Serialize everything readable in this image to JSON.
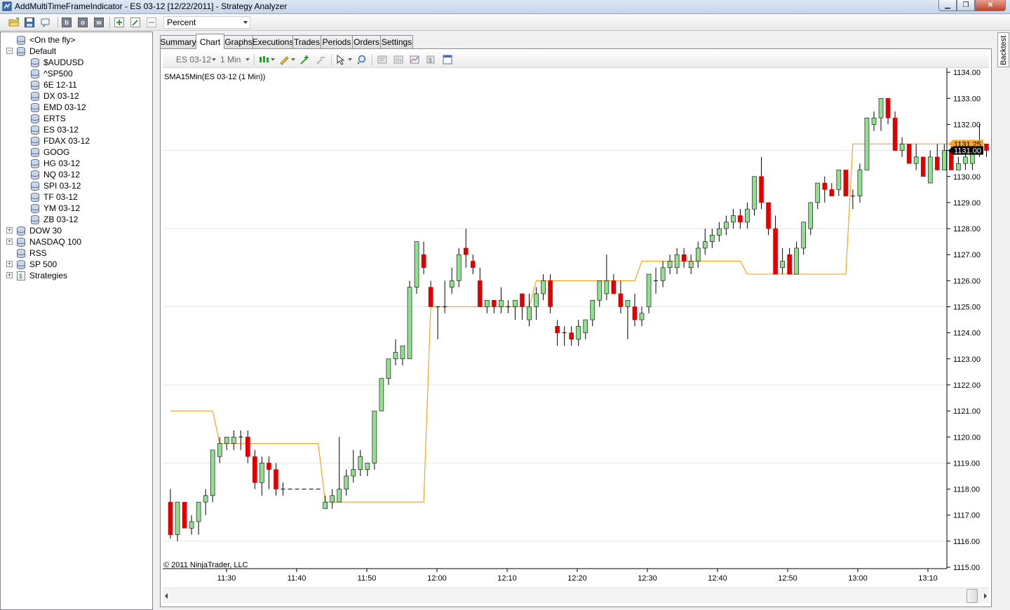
{
  "window": {
    "title": "AddMultiTimeFrameIndicator - ES 03-12 [12/22/2011] - Strategy Analyzer",
    "minimize": "▁",
    "maximize": "❐",
    "close": "✕"
  },
  "toolbar": {
    "b_label": "b",
    "o_label": "o",
    "w_label": "w",
    "display_select": "Percent"
  },
  "tree": {
    "items": [
      {
        "label": "<On the fly>",
        "level": 1,
        "expander": ""
      },
      {
        "label": "Default",
        "level": 0,
        "expander": "−"
      },
      {
        "label": "$AUDUSD",
        "level": 2,
        "expander": ""
      },
      {
        "label": "^SP500",
        "level": 2,
        "expander": ""
      },
      {
        "label": "6E 12-11",
        "level": 2,
        "expander": ""
      },
      {
        "label": "DX 03-12",
        "level": 2,
        "expander": ""
      },
      {
        "label": "EMD 03-12",
        "level": 2,
        "expander": ""
      },
      {
        "label": "ERTS",
        "level": 2,
        "expander": ""
      },
      {
        "label": "ES 03-12",
        "level": 2,
        "expander": ""
      },
      {
        "label": "FDAX 03-12",
        "level": 2,
        "expander": ""
      },
      {
        "label": "GOOG",
        "level": 2,
        "expander": ""
      },
      {
        "label": "HG 03-12",
        "level": 2,
        "expander": ""
      },
      {
        "label": "NQ 03-12",
        "level": 2,
        "expander": ""
      },
      {
        "label": "SPI 03-12",
        "level": 2,
        "expander": ""
      },
      {
        "label": "TF 03-12",
        "level": 2,
        "expander": ""
      },
      {
        "label": "YM 03-12",
        "level": 2,
        "expander": ""
      },
      {
        "label": "ZB 03-12",
        "level": 2,
        "expander": ""
      },
      {
        "label": "DOW 30",
        "level": 0,
        "expander": "+"
      },
      {
        "label": "NASDAQ 100",
        "level": 0,
        "expander": "+"
      },
      {
        "label": "RSS",
        "level": 0,
        "expander": ""
      },
      {
        "label": "SP 500",
        "level": 0,
        "expander": "+"
      },
      {
        "label": "Strategies",
        "level": 0,
        "expander": "+"
      }
    ]
  },
  "tabs": [
    "Summary",
    "Chart",
    "Graphs",
    "Executions",
    "Trades",
    "Periods",
    "Orders",
    "Settings"
  ],
  "active_tab": "Chart",
  "side_tab": "Backtest",
  "chart_toolbar": {
    "instrument": "ES 03-12",
    "interval": "1 Min"
  },
  "chart_data": {
    "type": "candlestick",
    "indicator_label": "SMA15Min(ES 03-12 (1 Min))",
    "copyright": "© 2011 NinjaTrader, LLC",
    "ylim": [
      1115,
      1134
    ],
    "y_ticks": [
      "1115.00",
      "1116.00",
      "1117.00",
      "1118.00",
      "1119.00",
      "1120.00",
      "1121.00",
      "1122.00",
      "1123.00",
      "1124.00",
      "1125.00",
      "1126.00",
      "1127.00",
      "1128.00",
      "1129.00",
      "1130.00",
      "1131.00",
      "1132.00",
      "1133.00",
      "1134.00"
    ],
    "x_ticks": [
      "11:30",
      "11:40",
      "11:50",
      "12:00",
      "12:10",
      "12:20",
      "12:30",
      "12:40",
      "12:50",
      "13:00",
      "13:10"
    ],
    "up_color": "#90e090",
    "down_color": "#e00000",
    "sma_color": "#f5a623",
    "price_markers": [
      {
        "label": "1131.25",
        "value": 1131.25,
        "color": "#f5a623"
      },
      {
        "label": "1131.00",
        "value": 1131.0,
        "color": "#000000"
      }
    ],
    "candles": [
      [
        1117.5,
        1118.0,
        1116.1,
        1116.25
      ],
      [
        1116.25,
        1117.5,
        1116.0,
        1117.5
      ],
      [
        1117.5,
        1117.5,
        1116.5,
        1116.5
      ],
      [
        1116.5,
        1117.0,
        1116.25,
        1116.75
      ],
      [
        1116.75,
        1117.5,
        1116.25,
        1117.5
      ],
      [
        1117.5,
        1118.0,
        1117.0,
        1117.75
      ],
      [
        1117.75,
        1119.5,
        1117.5,
        1119.5
      ],
      [
        1119.25,
        1120.0,
        1119.0,
        1119.75
      ],
      [
        1119.75,
        1120.0,
        1119.5,
        1120.0
      ],
      [
        1119.75,
        1120.25,
        1119.5,
        1120.0
      ],
      [
        1120.0,
        1120.25,
        1119.5,
        1120.0
      ],
      [
        1120.0,
        1120.25,
        1119.0,
        1119.25
      ],
      [
        1119.25,
        1119.5,
        1118.0,
        1118.25
      ],
      [
        1118.25,
        1119.25,
        1117.75,
        1119.0
      ],
      [
        1119.0,
        1119.25,
        1118.0,
        1118.75
      ],
      [
        1118.75,
        1119.0,
        1117.75,
        1118.0
      ],
      [
        1118.0,
        1118.25,
        1117.75,
        1118.0
      ],
      [
        1118.0,
        1118.0,
        1118.0,
        1118.0
      ],
      [
        1118.0,
        1118.0,
        1118.0,
        1118.0
      ],
      [
        1118.0,
        1118.0,
        1118.0,
        1118.0
      ],
      [
        1118.0,
        1118.0,
        1118.0,
        1118.0
      ],
      [
        1118.0,
        1118.0,
        1118.0,
        1118.0
      ],
      [
        1117.25,
        1117.75,
        1117.25,
        1117.5
      ],
      [
        1117.5,
        1118.0,
        1117.25,
        1117.75
      ],
      [
        1117.5,
        1120.0,
        1117.5,
        1118.0
      ],
      [
        1118.0,
        1118.75,
        1117.75,
        1118.5
      ],
      [
        1118.5,
        1119.5,
        1118.25,
        1118.75
      ],
      [
        1118.75,
        1119.5,
        1118.5,
        1119.25
      ],
      [
        1118.75,
        1119.0,
        1118.5,
        1119.0
      ],
      [
        1119.0,
        1121.0,
        1118.75,
        1121.0
      ],
      [
        1121.0,
        1122.25,
        1121.0,
        1122.25
      ],
      [
        1122.25,
        1123.0,
        1122.0,
        1123.0
      ],
      [
        1123.0,
        1123.75,
        1122.75,
        1123.25
      ],
      [
        1123.0,
        1123.5,
        1122.75,
        1123.5
      ],
      [
        1123.0,
        1126.0,
        1123.0,
        1125.75
      ],
      [
        1125.75,
        1127.5,
        1125.5,
        1127.5
      ],
      [
        1127.0,
        1127.5,
        1126.25,
        1126.5
      ],
      [
        1125.75,
        1126.0,
        1125.0,
        1125.0
      ],
      [
        1125.0,
        1125.0,
        1123.75,
        1125.0
      ],
      [
        1125.0,
        1126.0,
        1124.75,
        1125.0
      ],
      [
        1125.75,
        1126.5,
        1125.5,
        1126.0
      ],
      [
        1126.0,
        1127.25,
        1125.75,
        1127.0
      ],
      [
        1127.25,
        1128.0,
        1126.5,
        1127.0
      ],
      [
        1126.75,
        1127.0,
        1126.25,
        1126.5
      ],
      [
        1126.0,
        1126.5,
        1125.0,
        1125.0
      ],
      [
        1125.0,
        1125.25,
        1124.75,
        1125.25
      ],
      [
        1125.25,
        1125.25,
        1124.75,
        1125.0
      ],
      [
        1125.0,
        1125.75,
        1124.75,
        1125.25
      ],
      [
        1125.0,
        1125.25,
        1124.75,
        1125.0
      ],
      [
        1125.0,
        1125.25,
        1124.5,
        1125.25
      ],
      [
        1125.5,
        1125.5,
        1124.5,
        1125.0
      ],
      [
        1124.5,
        1125.5,
        1124.25,
        1125.0
      ],
      [
        1125.0,
        1125.75,
        1124.5,
        1125.5
      ],
      [
        1125.5,
        1126.25,
        1125.25,
        1126.0
      ],
      [
        1126.0,
        1126.25,
        1124.75,
        1125.0
      ],
      [
        1124.25,
        1124.5,
        1123.5,
        1124.0
      ],
      [
        1124.0,
        1124.25,
        1123.5,
        1124.0
      ],
      [
        1124.0,
        1124.25,
        1123.5,
        1123.75
      ],
      [
        1123.75,
        1124.5,
        1123.5,
        1124.25
      ],
      [
        1124.0,
        1124.5,
        1123.75,
        1124.5
      ],
      [
        1124.5,
        1125.25,
        1124.25,
        1125.25
      ],
      [
        1125.25,
        1126.0,
        1125.0,
        1126.0
      ],
      [
        1125.5,
        1127.0,
        1125.25,
        1126.0
      ],
      [
        1126.0,
        1126.25,
        1125.5,
        1125.5
      ],
      [
        1125.5,
        1126.0,
        1124.75,
        1125.0
      ],
      [
        1125.0,
        1125.25,
        1123.75,
        1125.25
      ],
      [
        1125.0,
        1125.5,
        1124.25,
        1124.5
      ],
      [
        1124.5,
        1125.0,
        1124.25,
        1124.75
      ],
      [
        1125.0,
        1126.25,
        1124.75,
        1126.25
      ],
      [
        1126.0,
        1126.5,
        1125.5,
        1126.0
      ],
      [
        1126.0,
        1126.75,
        1125.75,
        1126.5
      ],
      [
        1126.5,
        1127.0,
        1126.25,
        1126.75
      ],
      [
        1126.5,
        1127.25,
        1126.25,
        1127.0
      ],
      [
        1127.0,
        1127.25,
        1126.5,
        1126.75
      ],
      [
        1126.5,
        1127.0,
        1126.25,
        1126.75
      ],
      [
        1126.75,
        1127.5,
        1126.5,
        1127.25
      ],
      [
        1127.25,
        1128.0,
        1127.0,
        1127.5
      ],
      [
        1127.5,
        1128.0,
        1127.25,
        1127.75
      ],
      [
        1127.75,
        1128.25,
        1127.5,
        1128.0
      ],
      [
        1128.0,
        1128.5,
        1127.75,
        1128.25
      ],
      [
        1128.25,
        1128.75,
        1128.0,
        1128.5
      ],
      [
        1128.5,
        1128.75,
        1128.0,
        1128.25
      ],
      [
        1128.25,
        1129.0,
        1128.0,
        1128.75
      ],
      [
        1128.75,
        1130.0,
        1128.5,
        1130.0
      ],
      [
        1130.0,
        1130.75,
        1128.75,
        1129.0
      ],
      [
        1129.0,
        1129.0,
        1127.75,
        1128.0
      ],
      [
        1128.0,
        1128.5,
        1126.25,
        1126.25
      ],
      [
        1126.5,
        1127.25,
        1126.25,
        1126.75
      ],
      [
        1127.0,
        1127.25,
        1126.25,
        1126.25
      ],
      [
        1126.25,
        1127.5,
        1126.25,
        1127.25
      ],
      [
        1127.25,
        1128.25,
        1127.0,
        1128.25
      ],
      [
        1128.0,
        1129.0,
        1127.75,
        1129.0
      ],
      [
        1129.0,
        1129.75,
        1128.75,
        1129.75
      ],
      [
        1129.75,
        1130.0,
        1129.0,
        1129.5
      ],
      [
        1129.5,
        1129.75,
        1129.25,
        1129.25
      ],
      [
        1129.5,
        1130.25,
        1129.25,
        1130.25
      ],
      [
        1130.25,
        1130.25,
        1129.25,
        1129.25
      ],
      [
        1129.25,
        1129.5,
        1128.75,
        1129.25
      ],
      [
        1129.25,
        1130.5,
        1129.0,
        1130.25
      ],
      [
        1130.25,
        1132.25,
        1130.25,
        1132.25
      ],
      [
        1132.0,
        1132.5,
        1131.75,
        1132.25
      ],
      [
        1132.25,
        1133.0,
        1131.75,
        1133.0
      ],
      [
        1133.0,
        1133.0,
        1132.0,
        1132.25
      ],
      [
        1132.25,
        1132.5,
        1131.0,
        1131.0
      ],
      [
        1131.0,
        1131.5,
        1130.75,
        1131.25
      ],
      [
        1131.25,
        1131.25,
        1130.5,
        1130.5
      ],
      [
        1130.5,
        1131.25,
        1130.25,
        1130.75
      ],
      [
        1130.75,
        1130.75,
        1130.0,
        1130.0
      ],
      [
        1129.75,
        1131.0,
        1129.75,
        1130.75
      ],
      [
        1130.75,
        1131.25,
        1130.25,
        1130.25
      ],
      [
        1130.25,
        1131.25,
        1130.25,
        1131.0
      ],
      [
        1131.0,
        1131.25,
        1130.25,
        1130.25
      ],
      [
        1130.25,
        1130.75,
        1130.25,
        1130.5
      ],
      [
        1130.5,
        1131.25,
        1130.25,
        1130.75
      ],
      [
        1130.5,
        1131.25,
        1130.25,
        1131.0
      ],
      [
        1131.0,
        1132.0,
        1130.75,
        1131.25
      ],
      [
        1131.25,
        1131.25,
        1130.75,
        1131.0
      ]
    ],
    "sma_steps": [
      [
        0,
        1121.0
      ],
      [
        7,
        1119.75
      ],
      [
        22,
        1117.5
      ],
      [
        37,
        1125.0
      ],
      [
        52,
        1126.0
      ],
      [
        67,
        1126.75
      ],
      [
        82,
        1126.25
      ],
      [
        97,
        1131.25
      ]
    ]
  }
}
